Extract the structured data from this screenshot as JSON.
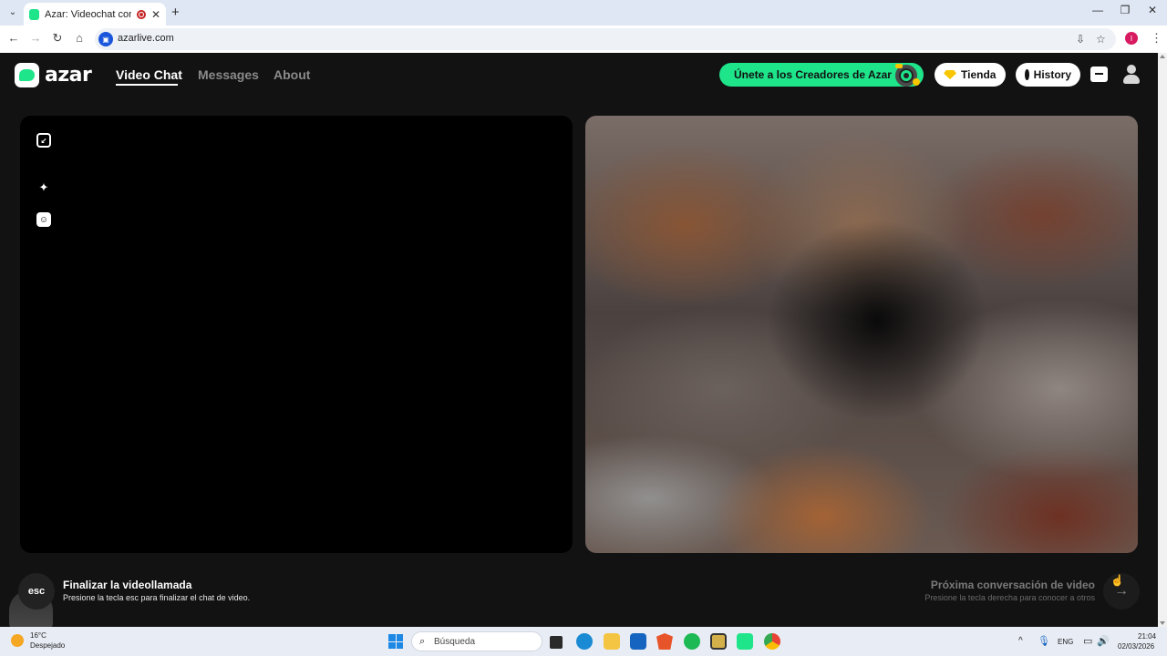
{
  "browser": {
    "tab_title": "Azar: Videochat con gente",
    "url": "azarlive.com",
    "profile_initial": "I"
  },
  "header": {
    "logo_text": "azar",
    "nav": [
      {
        "label": "Video Chat",
        "active": true
      },
      {
        "label": "Messages",
        "active": false
      },
      {
        "label": "About",
        "active": false
      }
    ],
    "creators_label": "Únete a los Creadores de Azar",
    "shop_label": "Tienda",
    "history_label": "History"
  },
  "bottom": {
    "esc_key": "esc",
    "end_title": "Finalizar la videollamada",
    "end_subtitle": "Presione la tecla esc para finalizar el chat de video.",
    "next_title": "Próxima conversación de video",
    "next_subtitle": "Presione la tecla derecha para conocer a otros"
  },
  "taskbar": {
    "temperature": "16°C",
    "weather": "Despejado",
    "search_placeholder": "Búsqueda",
    "language": "ENG",
    "time": "21:04",
    "date": "02/03/2026"
  },
  "colors": {
    "brand_green": "#1ee48a",
    "page_bg": "#121212"
  }
}
